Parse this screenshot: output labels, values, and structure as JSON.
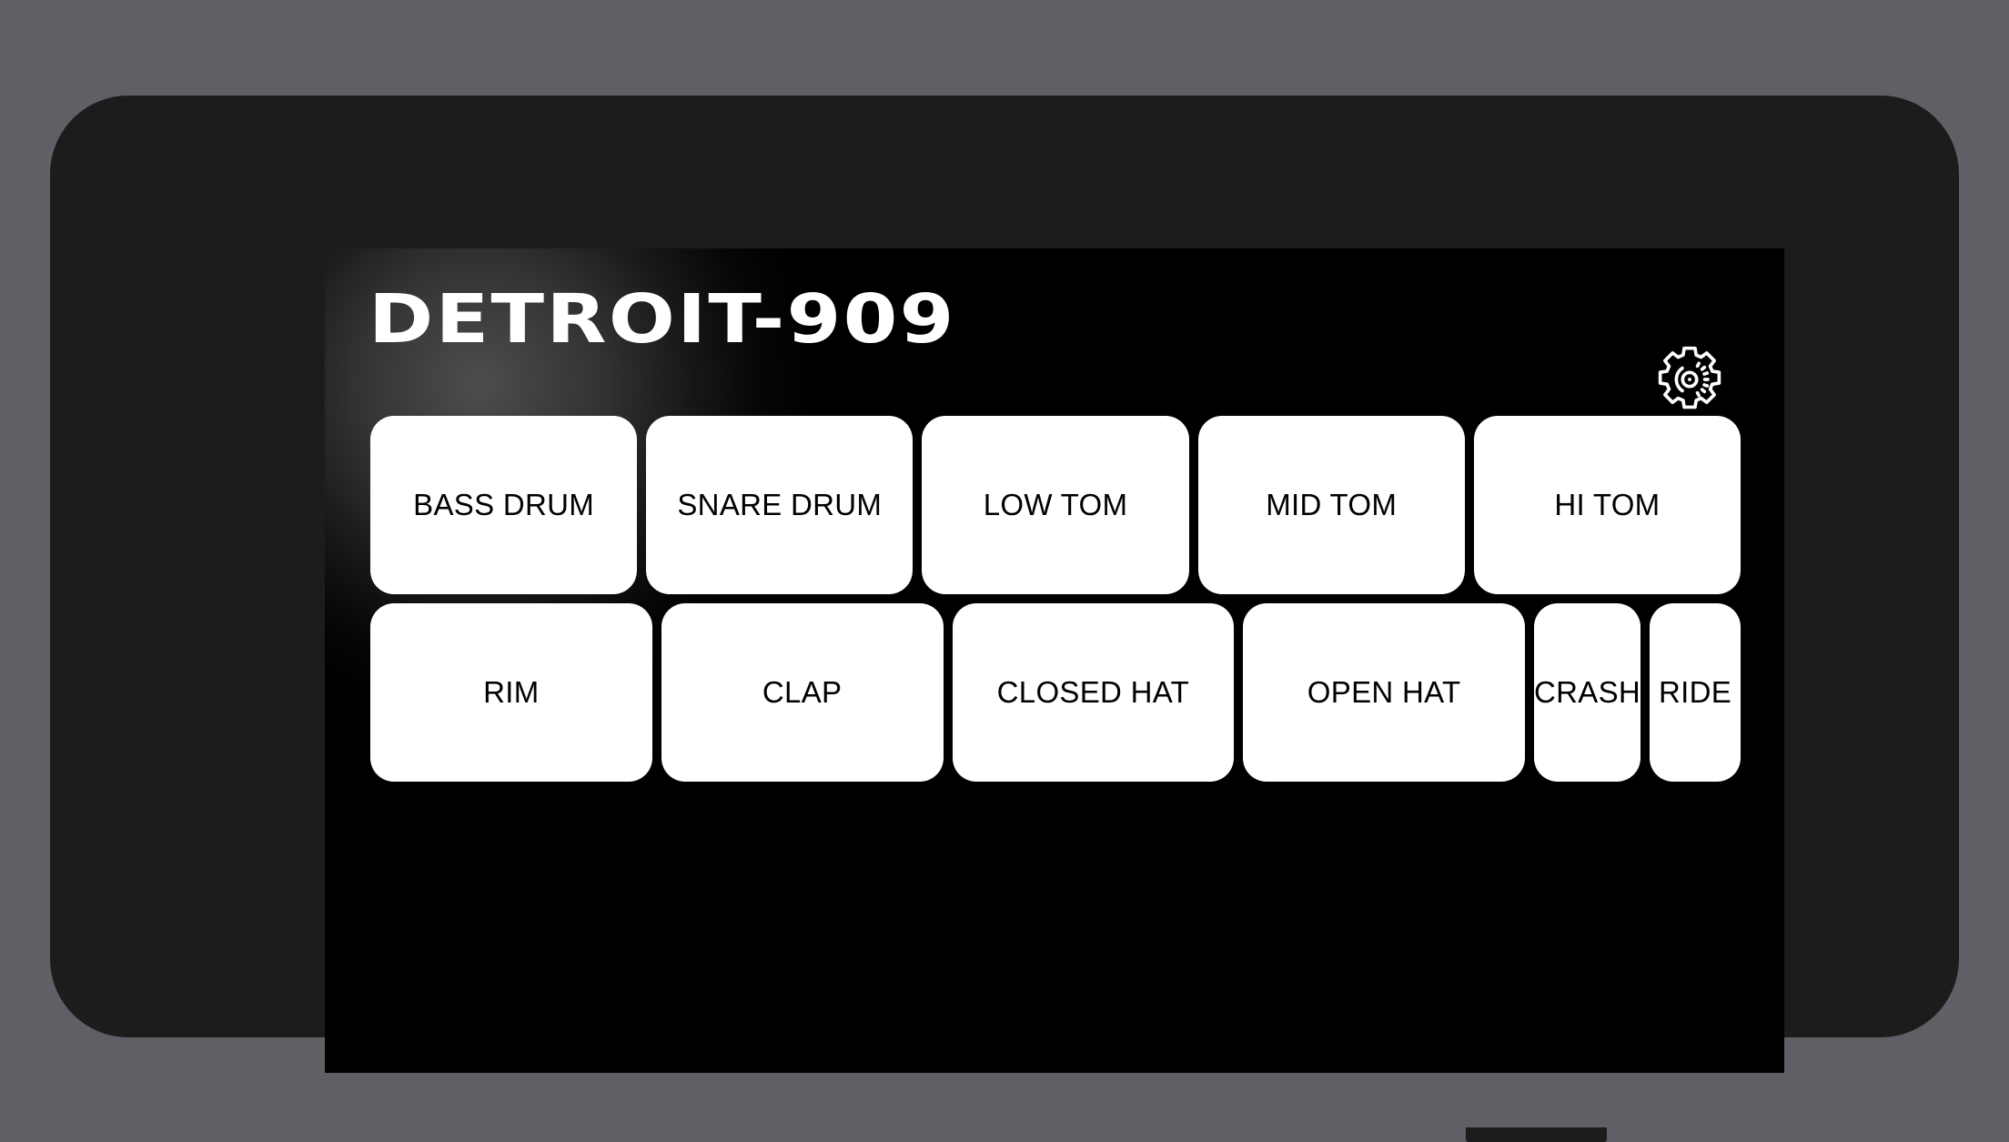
{
  "app": {
    "title": "DETROIT-909",
    "settings_icon": "gear-icon"
  },
  "device": {
    "buttons": [
      {
        "name": "volume-up-button"
      },
      {
        "name": "volume-down-button"
      },
      {
        "name": "mute-switch-button"
      },
      {
        "name": "power-button"
      }
    ]
  },
  "pads": {
    "row1": [
      {
        "label": "BASS DRUM",
        "size": "wide"
      },
      {
        "label": "SNARE DRUM",
        "size": "wide"
      },
      {
        "label": "LOW TOM",
        "size": "wide"
      },
      {
        "label": "MID TOM",
        "size": "wide"
      },
      {
        "label": "HI TOM",
        "size": "wide"
      }
    ],
    "row2": [
      {
        "label": "RIM",
        "size": "wide"
      },
      {
        "label": "CLAP",
        "size": "wide"
      },
      {
        "label": "CLOSED HAT",
        "size": "wide"
      },
      {
        "label": "OPEN HAT",
        "size": "wide"
      },
      {
        "label": "CRASH",
        "size": "narrow"
      },
      {
        "label": "RIDE",
        "size": "narrow"
      }
    ]
  },
  "colors": {
    "background": "#5e6065",
    "device_body": "#1c1c1c",
    "screen": "#000000",
    "pad": "#ffffff",
    "pad_label": "#000000",
    "title": "#ffffff"
  }
}
